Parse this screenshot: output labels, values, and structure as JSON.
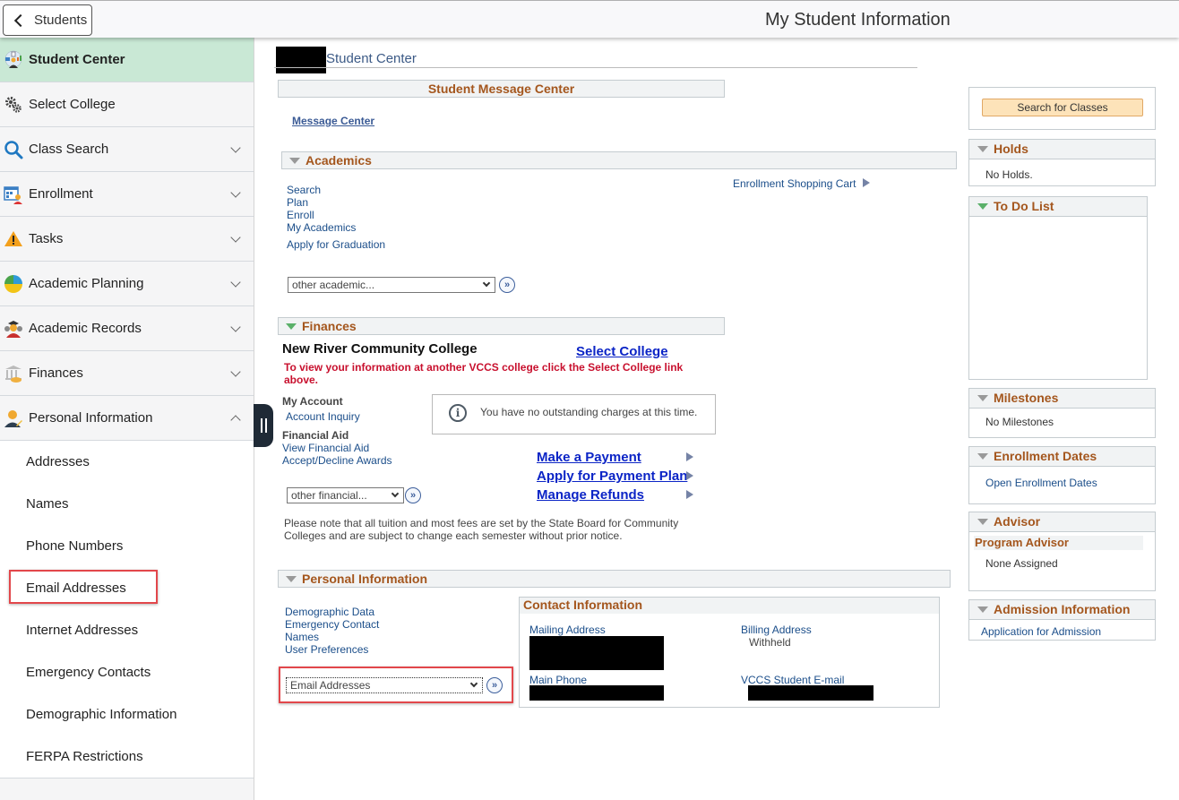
{
  "header": {
    "back_label": "Students",
    "title": "My Student Information"
  },
  "sidebar": {
    "items": [
      {
        "label": "Student Center",
        "icon": "student-center-icon",
        "active": true
      },
      {
        "label": "Select College",
        "icon": "gears-icon"
      },
      {
        "label": "Class Search",
        "icon": "search-icon",
        "expandable": true
      },
      {
        "label": "Enrollment",
        "icon": "calendar-icon",
        "expandable": true
      },
      {
        "label": "Tasks",
        "icon": "warning-icon",
        "expandable": true
      },
      {
        "label": "Academic Planning",
        "icon": "pie-chart-icon",
        "expandable": true
      },
      {
        "label": "Academic Records",
        "icon": "graduate-icon",
        "expandable": true
      },
      {
        "label": "Finances",
        "icon": "bank-icon",
        "expandable": true
      },
      {
        "label": "Personal Information",
        "icon": "person-edit-icon",
        "expanded": true
      }
    ],
    "sub_items": [
      "Addresses",
      "Names",
      "Phone Numbers",
      "Email Addresses",
      "Internet Addresses",
      "Emergency Contacts",
      "Demographic Information",
      "FERPA Restrictions"
    ]
  },
  "main": {
    "title": "Student Center",
    "message_center": {
      "header": "Student Message Center",
      "link": "Message Center"
    },
    "academics": {
      "header": "Academics",
      "links": [
        "Search",
        "Plan",
        "Enroll",
        "My Academics"
      ],
      "graduation_link": "Apply for Graduation",
      "shopping_cart": "Enrollment Shopping Cart",
      "select_value": "other academic..."
    },
    "finances": {
      "header": "Finances",
      "college": "New River Community College",
      "select_college": "Select College",
      "note": "To view your information at another VCCS college click the Select College link above.",
      "my_account_label": "My Account",
      "account_inquiry": "Account Inquiry",
      "financial_aid_label": "Financial Aid",
      "view_financial_aid": "View Financial Aid",
      "accept_decline": "Accept/Decline Awards",
      "info_message": "You have no outstanding charges at this time.",
      "make_payment": "Make a Payment",
      "payment_plan": "Apply for Payment Plan",
      "manage_refunds": "Manage Refunds",
      "select_value": "other financial...",
      "disclaimer": "Please note that all tuition and most fees are set by the State Board for Community Colleges and are subject to change each semester without prior notice."
    },
    "personal": {
      "header": "Personal Information",
      "links": [
        "Demographic Data",
        "Emergency Contact",
        "Names",
        "User Preferences"
      ],
      "select_value": "Email Addresses",
      "contact": {
        "header": "Contact Information",
        "mailing_label": "Mailing Address",
        "billing_label": "Billing Address",
        "billing_value": "Withheld",
        "phone_label": "Main Phone",
        "email_label": "VCCS Student E-mail"
      }
    }
  },
  "right": {
    "search_button": "Search for Classes",
    "holds": {
      "header": "Holds",
      "text": "No Holds."
    },
    "todo": {
      "header": "To Do List"
    },
    "milestones": {
      "header": "Milestones",
      "text": "No Milestones"
    },
    "enrollment_dates": {
      "header": "Enrollment Dates",
      "link": "Open Enrollment Dates"
    },
    "advisor": {
      "header": "Advisor",
      "sub_header": "Program Advisor",
      "text": "None Assigned"
    },
    "admission": {
      "header": "Admission Information",
      "link": "Application for Admission"
    }
  }
}
